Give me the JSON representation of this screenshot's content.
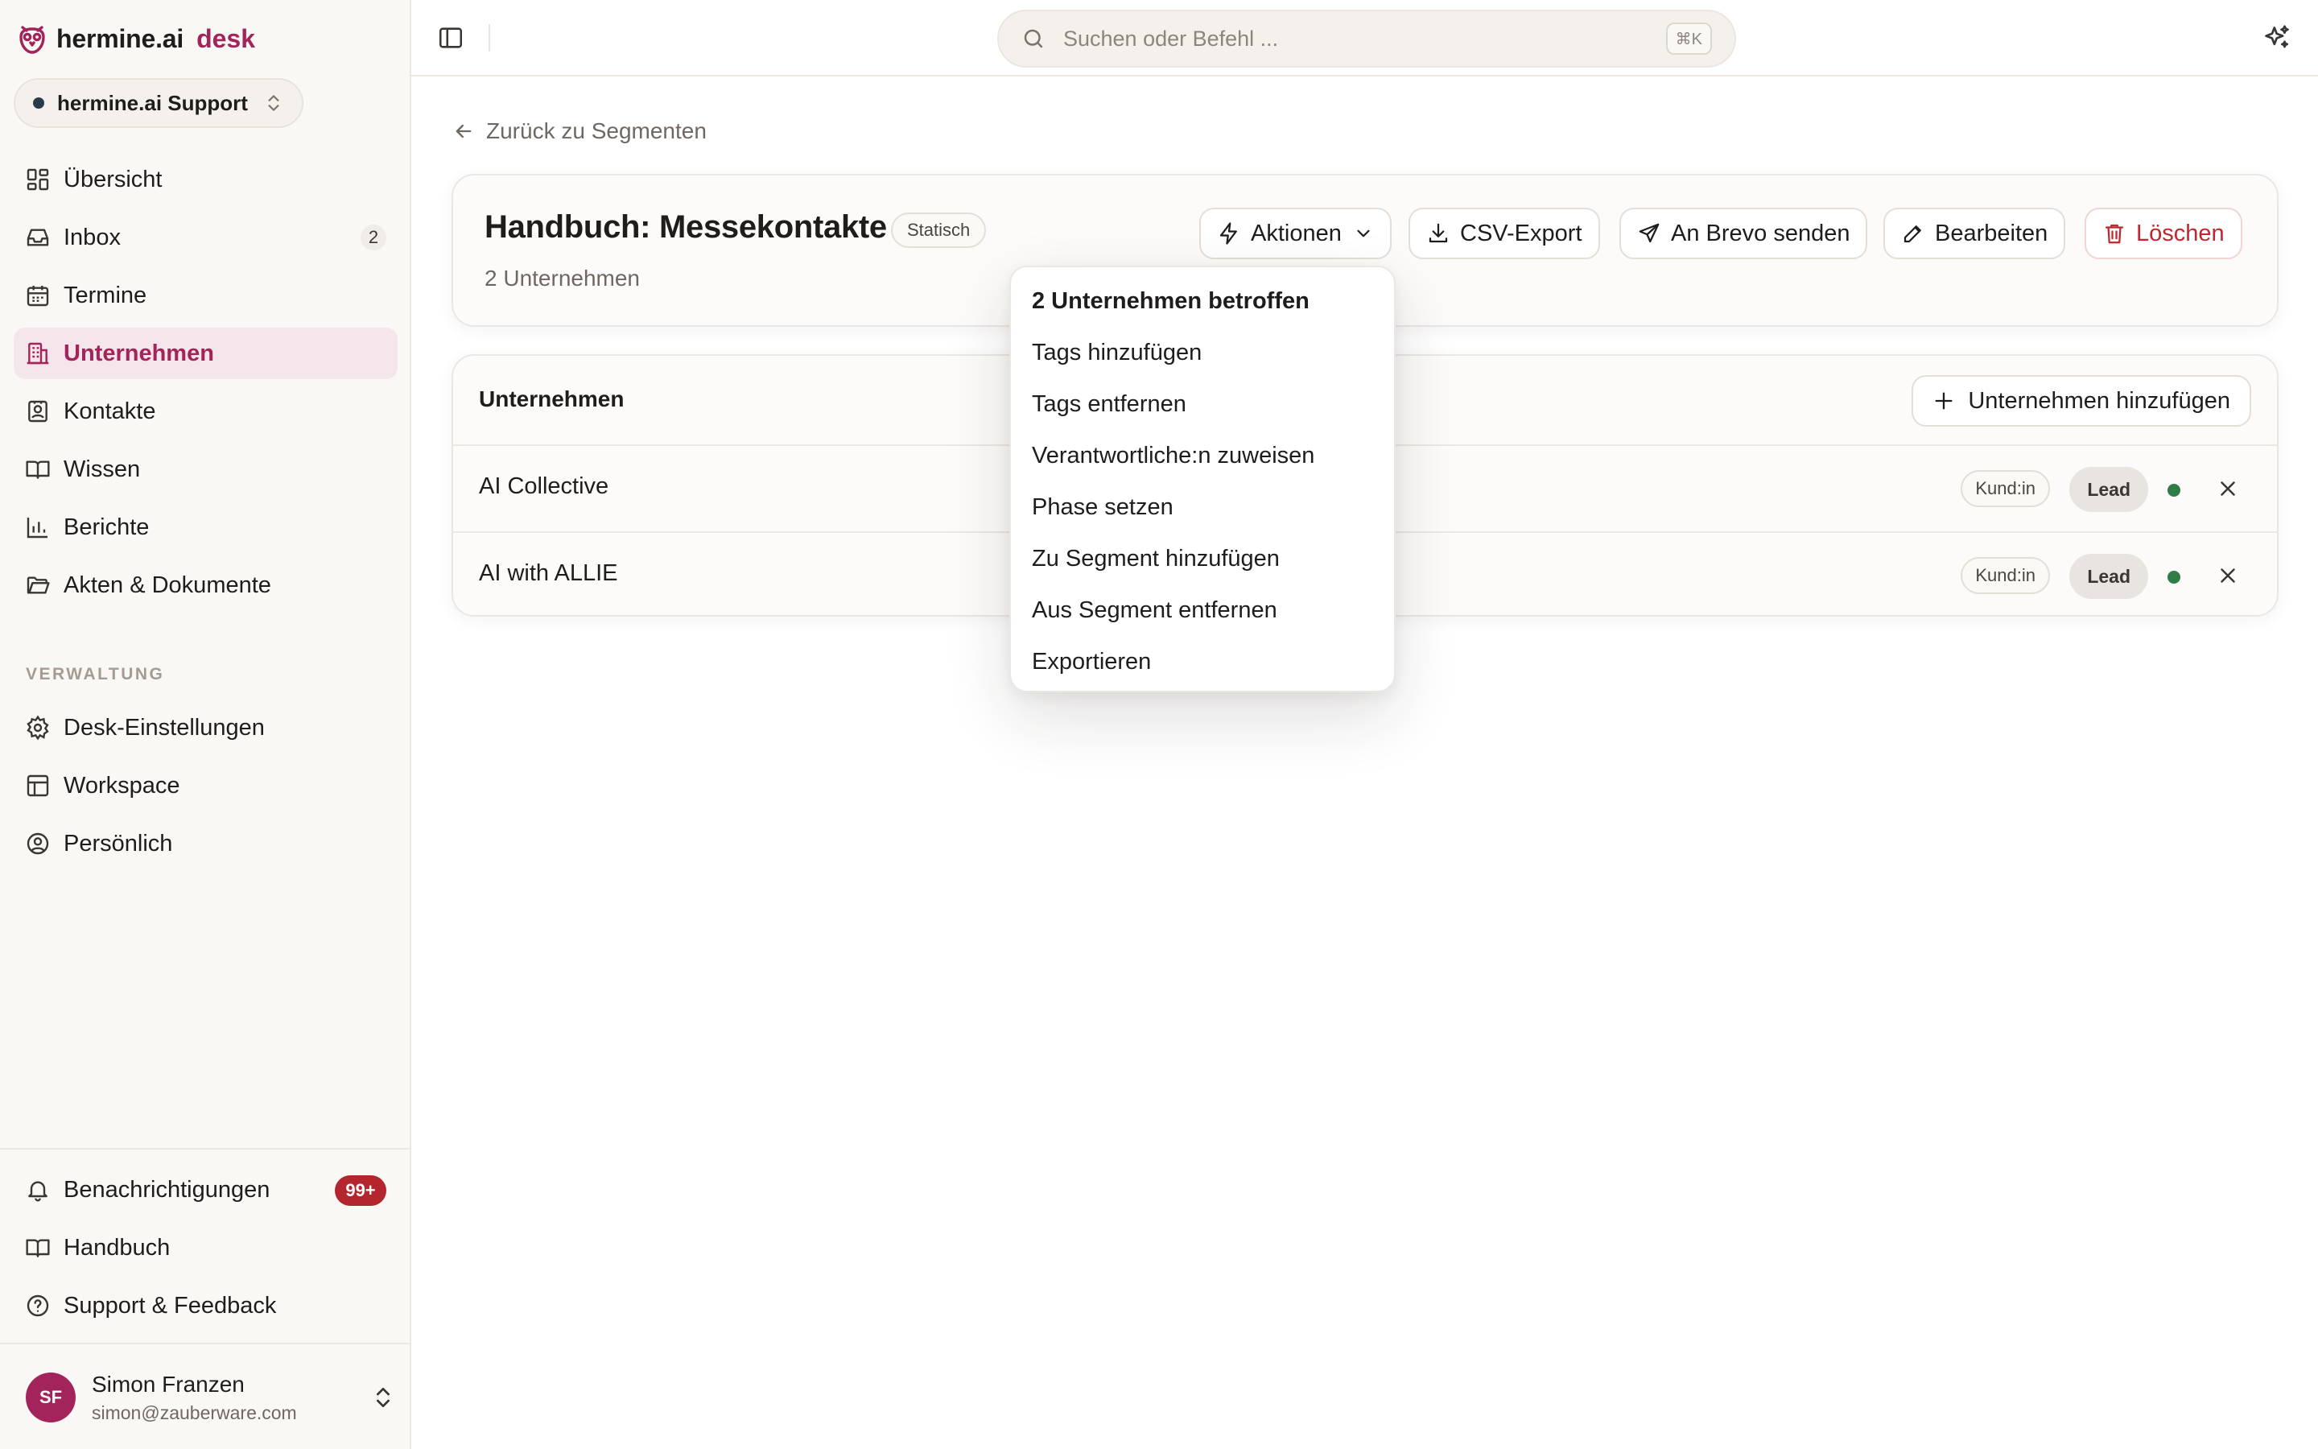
{
  "brand": {
    "name": "hermine.ai",
    "product": "desk",
    "accent": "#a3245a"
  },
  "workspace": {
    "label": "hermine.ai Support"
  },
  "nav": {
    "items": [
      {
        "label": "Übersicht",
        "icon": "dashboard-icon"
      },
      {
        "label": "Inbox",
        "icon": "inbox-icon",
        "count": "2"
      },
      {
        "label": "Termine",
        "icon": "calendar-icon"
      },
      {
        "label": "Unternehmen",
        "icon": "building-icon",
        "active": true
      },
      {
        "label": "Kontakte",
        "icon": "contact-icon"
      },
      {
        "label": "Wissen",
        "icon": "book-icon"
      },
      {
        "label": "Berichte",
        "icon": "bar-chart-icon"
      },
      {
        "label": "Akten & Dokumente",
        "icon": "folder-icon"
      }
    ],
    "section_label": "VERWALTUNG",
    "admin_items": [
      {
        "label": "Desk-Einstellungen",
        "icon": "gear-icon"
      },
      {
        "label": "Workspace",
        "icon": "layout-icon"
      },
      {
        "label": "Persönlich",
        "icon": "user-circle-icon"
      }
    ],
    "bottom_items": [
      {
        "label": "Benachrichtigungen",
        "icon": "bell-icon",
        "badge": "99+"
      },
      {
        "label": "Handbuch",
        "icon": "book-icon"
      },
      {
        "label": "Support & Feedback",
        "icon": "help-circle-icon"
      }
    ]
  },
  "user": {
    "initials": "SF",
    "name": "Simon Franzen",
    "email": "simon@zauberware.com"
  },
  "search": {
    "placeholder": "Suchen oder Befehl ...",
    "shortcut": "⌘K"
  },
  "back_link": "Zurück zu Segmenten",
  "segment": {
    "title": "Handbuch: Messekontakte",
    "type_chip": "Statisch",
    "subtitle": "2 Unternehmen",
    "actions": {
      "aktionen": "Aktionen",
      "csv_export": "CSV-Export",
      "brevo": "An Brevo senden",
      "edit": "Bearbeiten",
      "delete": "Löschen"
    }
  },
  "dropdown": {
    "header": "2 Unternehmen betroffen",
    "items": [
      "Tags hinzufügen",
      "Tags entfernen",
      "Verantwortliche:n zuweisen",
      "Phase setzen",
      "Zu Segment hinzufügen",
      "Aus Segment entfernen",
      "Exportieren"
    ]
  },
  "companies": {
    "title": "Unternehmen",
    "add_label": "Unternehmen hinzufügen",
    "rows": [
      {
        "name": "AI Collective",
        "type": "Kund:in",
        "phase": "Lead",
        "status_color": "#2f7d46"
      },
      {
        "name": "AI with ALLIE",
        "type": "Kund:in",
        "phase": "Lead",
        "status_color": "#2f7d46"
      }
    ]
  }
}
